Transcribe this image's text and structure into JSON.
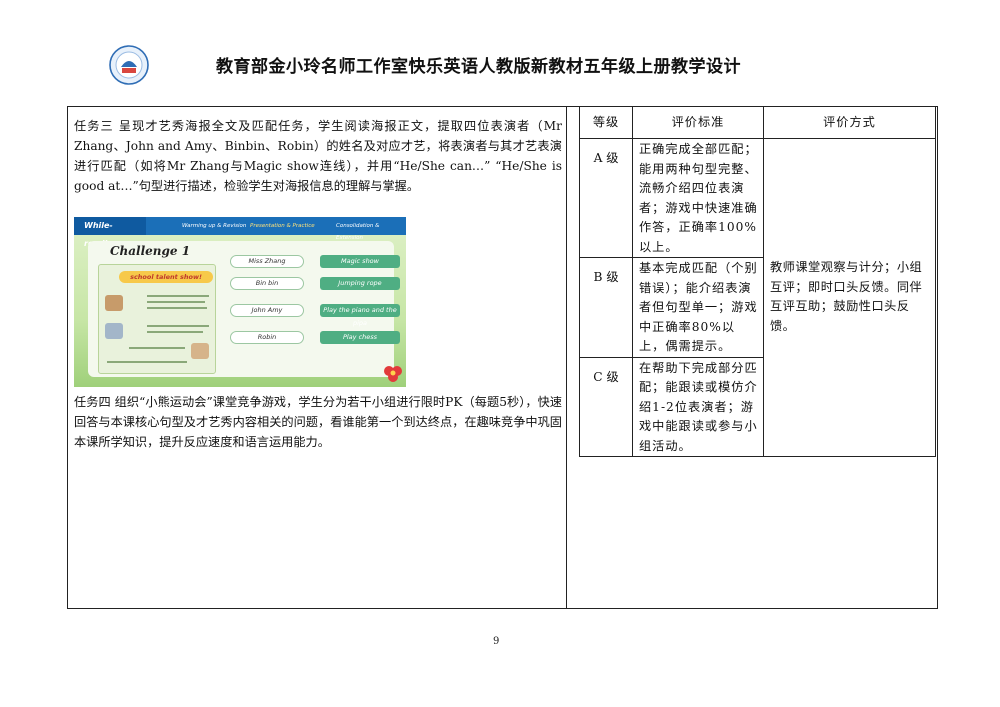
{
  "header": {
    "title": "教育部金小玲名师工作室快乐英语人教版新教材五年级上册教学设计"
  },
  "left": {
    "task3": "任务三 呈现才艺秀海报全文及匹配任务，学生阅读海报正文，提取四位表演者（Mr Zhang、John and Amy、Binbin、Robin）的姓名及对应才艺，将表演者与其才艺表演进行匹配（如将Mr Zhang与Magic show连线），并用“He/She can…” “He/She is good at…”句型进行描述，检验学生对海报信息的理解与掌握。",
    "task4": "任务四 组织“小熊运动会”课堂竞争游戏，学生分为若干小组进行限时PK（每题5秒），快速回答与本课核心句型及才艺秀内容相关的问题，看谁能第一个到达终点，在趣味竞争中巩固本课所学知识，提升反应速度和语言运用能力。"
  },
  "slide": {
    "section": "While-reading",
    "tabs": [
      "Warming up & Revision",
      "Presentation & Practice",
      "Consolidation & Extension"
    ],
    "challenge": "Challenge 1",
    "poster_title": "school talent show!",
    "names": [
      "Miss Zhang",
      "Bin bin",
      "John    Amy",
      "Robin"
    ],
    "talents": [
      "Magic show",
      "Jumping rope",
      "Play the piano and the pipa",
      "Play chess"
    ]
  },
  "table": {
    "headers": [
      "等级",
      "评价标准",
      "评价方式"
    ],
    "rows": [
      {
        "grade": "A 级",
        "criteria": "正确完成全部匹配；能用两种句型完整、流畅介绍四位表演者；游戏中快速准确作答，正确率100%以上。"
      },
      {
        "grade": "B 级",
        "criteria": "基本完成匹配（个别错误）；能介绍表演者但句型单一；游戏中正确率80%以上，偶需提示。"
      },
      {
        "grade": "C 级",
        "criteria": "在帮助下完成部分匹配；能跟读或模仿介绍1-2位表演者；游戏中能跟读或参与小组活动。"
      }
    ],
    "method": "教师课堂观察与计分；小组互评；即时口头反馈。同伴互评互助；鼓励性口头反馈。"
  },
  "footer": {
    "page": "9"
  }
}
